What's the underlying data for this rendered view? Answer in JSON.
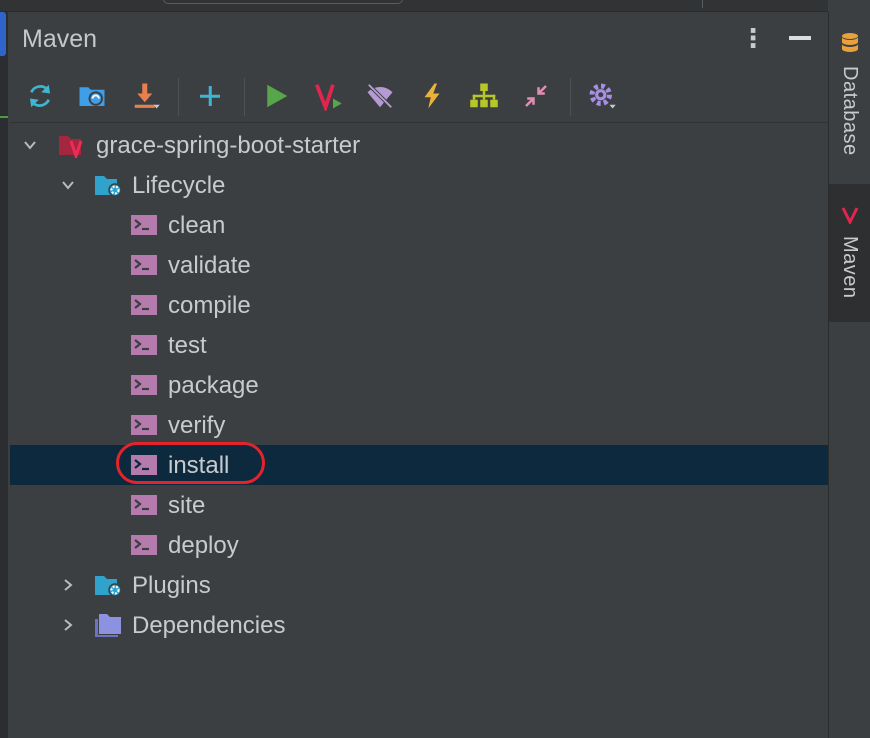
{
  "panel": {
    "title": "Maven",
    "header_actions": [
      "more-options",
      "minimize"
    ]
  },
  "toolbar": {
    "buttons": [
      "reload-all-projects",
      "generate-sources-and-update-folders",
      "download-sources",
      "add-maven-project",
      "run-maven-build",
      "execute-maven-goal",
      "toggle-offline-mode",
      "skip-tests",
      "show-dependencies",
      "collapse-all",
      "maven-settings"
    ]
  },
  "tree": {
    "project": {
      "label": "grace-spring-boot-starter",
      "expanded": true
    },
    "lifecycle": {
      "label": "Lifecycle",
      "expanded": true,
      "goals": [
        "clean",
        "validate",
        "compile",
        "test",
        "package",
        "verify",
        "install",
        "site",
        "deploy"
      ],
      "selected": "install"
    },
    "plugins": {
      "label": "Plugins",
      "expanded": false
    },
    "dependencies": {
      "label": "Dependencies",
      "expanded": false
    }
  },
  "sidebar": {
    "tabs": [
      {
        "label": "Database",
        "active": false
      },
      {
        "label": "Maven",
        "active": true
      }
    ]
  },
  "colors": {
    "panel_bg": "#3c3f41",
    "selection_bg": "#0d293e",
    "highlight_outline": "#e6232b",
    "maven_red": "#e2254e",
    "goal_icon": "#b47bac"
  }
}
